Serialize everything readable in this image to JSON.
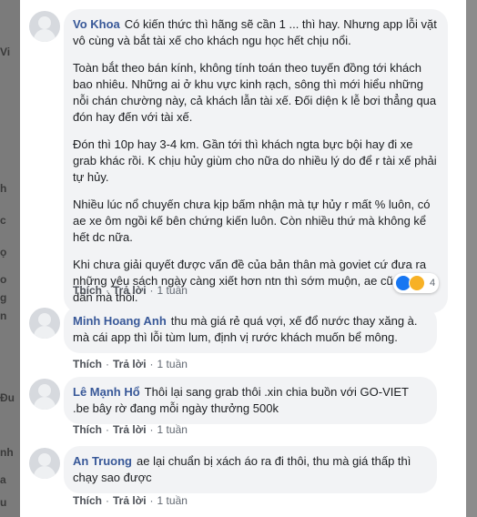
{
  "side_fragments": [
    "Vi",
    "h",
    "c",
    "ọ",
    "o",
    "g",
    "n",
    "Đu",
    "nh",
    "a",
    "u"
  ],
  "comments": [
    {
      "author": "Vo Khoa",
      "paragraphs": [
        "Có kiến thức thì hãng sẽ cần 1 ... thì hay. Nhưng app lỗi vặt vô cùng và bắt tài xế cho khách ngu học hết chịu nổi.",
        "Toàn bắt theo bán kính, không tính toán theo tuyến đồng tới khách bao nhiêu. Những ai ở khu vực kinh rạch, sông thì mới hiểu những nỗi chán chường này, cả khách lẫn tài xế. Đối diện k lễ bơi thẳng qua đón hay đến với tài xế.",
        "Đón thì 10p hay 3-4 km. Gần tới thì khách ngta bực bội hay đi xe grab khác rồi. K chịu hủy giùm cho nữa do nhiều lý do để r tài xế phải tự hủy.",
        "Nhiều lúc nổ chuyến chưa kịp bấm nhận mà tự hủy r mất % luôn, có ae xe ôm ngồi kế bên chứng kiến luôn. Còn nhiều thứ mà không kể hết dc nữa.",
        "Khi chưa giải quyết được vấn đề của bản thân mà goviet cứ đưa ra những yêu sách ngày càng xiết hơn ntn thì sớm muộn, ae cũng bỏ đi dần mà thôi."
      ],
      "actions": {
        "like": "Thích",
        "reply": "Trả lời",
        "time": "1 tuần"
      },
      "reaction_count": "4"
    },
    {
      "author": "Minh Hoang Anh",
      "text": "thu mà giá rẻ quá vợi, xế đổ nước thay xăng à. mà cái app thì lỗi tùm lum, định vị rước khách muốn bể mông.",
      "actions": {
        "like": "Thích",
        "reply": "Trả lời",
        "time": "1 tuần"
      }
    },
    {
      "author": "Lê Mạnh Hổ",
      "text": "Thôi lại sang grab thôi .xin chia buồn với GO-VIET .be bây rờ đang mỗi ngày thưởng 500k",
      "actions": {
        "like": "Thích",
        "reply": "Trả lời",
        "time": "1 tuần"
      }
    },
    {
      "author": "An Truong",
      "text": "ae lại chuẩn bị xách áo ra đi thôi, thu mà giá thấp thì chạy sao được",
      "actions": {
        "like": "Thích",
        "reply": "Trả lời",
        "time": "1 tuần"
      }
    }
  ],
  "colors": {
    "author": "#385898",
    "bubble": "#f2f3f5",
    "like_icon": "#1877f2",
    "haha_icon": "#f7b125"
  }
}
